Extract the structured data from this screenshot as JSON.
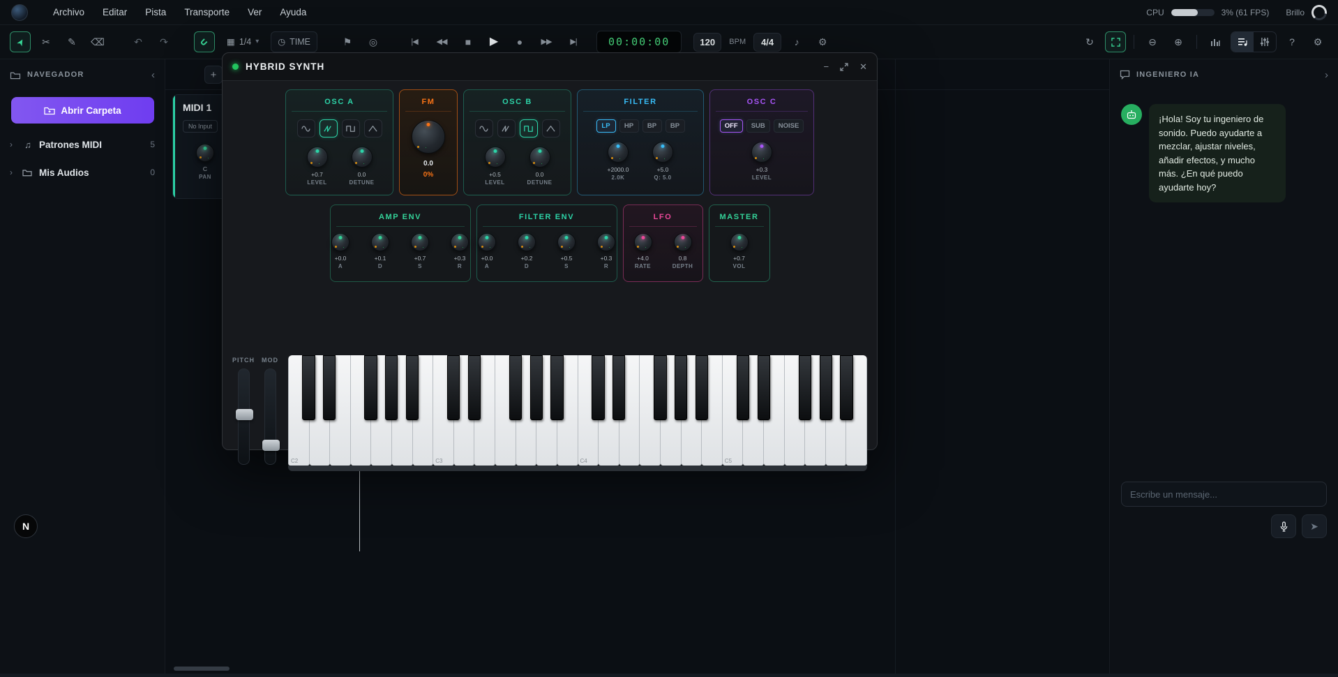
{
  "menubar": {
    "items": [
      "Archivo",
      "Editar",
      "Pista",
      "Transporte",
      "Ver",
      "Ayuda"
    ],
    "cpu_label": "CPU",
    "cpu_text": "3% (61 FPS)",
    "cpu_fill_pct": 62,
    "brightness_label": "Brillo"
  },
  "toolbar": {
    "grid_value": "1/4",
    "time_mode_label": "TIME",
    "timecode": "00:00:00",
    "tempo": "120",
    "tempo_unit": "BPM",
    "time_signature": "4/4"
  },
  "navigator": {
    "title": "NAVEGADOR",
    "open_folder_label": "Abrir Carpeta",
    "items": [
      {
        "label": "Patrones MIDI",
        "count": "5"
      },
      {
        "label": "Mis Audios",
        "count": "0"
      }
    ]
  },
  "timeline": {
    "add_track_label": "+",
    "track": {
      "name": "MIDI 1",
      "input_label": "No Input",
      "pan_value": "C",
      "pan_label": "PAN"
    }
  },
  "synth": {
    "title": "HYBRID SYNTH",
    "osc_a": {
      "title": "OSC A",
      "waves": [
        "sine",
        "saw",
        "square",
        "triangle"
      ],
      "selected_wave": 1,
      "knobs": [
        {
          "value": "+0.7",
          "label": "LEVEL"
        },
        {
          "value": "0.0",
          "label": "DETUNE"
        }
      ]
    },
    "fm": {
      "title": "FM",
      "value": "0.0",
      "amount": "0%"
    },
    "osc_b": {
      "title": "OSC B",
      "waves": [
        "sine",
        "saw",
        "square",
        "triangle"
      ],
      "selected_wave": 2,
      "knobs": [
        {
          "value": "+0.5",
          "label": "LEVEL"
        },
        {
          "value": "0.0",
          "label": "DETUNE"
        }
      ]
    },
    "filter": {
      "title": "FILTER",
      "modes": [
        "LP",
        "HP",
        "BP",
        "BP"
      ],
      "selected_mode": 0,
      "knobs": [
        {
          "value": "+2000.0",
          "label": "2.0K"
        },
        {
          "value": "+5.0",
          "label": "Q: 5.0"
        }
      ]
    },
    "osc_c": {
      "title": "OSC C",
      "modes": [
        "OFF",
        "SUB",
        "NOISE"
      ],
      "selected_mode": 0,
      "knobs": [
        {
          "value": "+0.3",
          "label": "LEVEL"
        }
      ]
    },
    "amp_env": {
      "title": "AMP ENV",
      "knobs": [
        {
          "value": "+0.0",
          "label": "A"
        },
        {
          "value": "+0.1",
          "label": "D"
        },
        {
          "value": "+0.7",
          "label": "S"
        },
        {
          "value": "+0.3",
          "label": "R"
        }
      ]
    },
    "filter_env": {
      "title": "FILTER ENV",
      "knobs": [
        {
          "value": "+0.0",
          "label": "A"
        },
        {
          "value": "+0.2",
          "label": "D"
        },
        {
          "value": "+0.5",
          "label": "S"
        },
        {
          "value": "+0.3",
          "label": "R"
        }
      ]
    },
    "lfo": {
      "title": "LFO",
      "knobs": [
        {
          "value": "+4.0",
          "label": "RATE"
        },
        {
          "value": "0.8",
          "label": "DEPTH"
        }
      ]
    },
    "master": {
      "title": "MASTER",
      "knobs": [
        {
          "value": "+0.7",
          "label": "VOL"
        }
      ]
    },
    "wheels": {
      "pitch_label": "PITCH",
      "mod_label": "MOD"
    },
    "keyboard": {
      "octaves": 4,
      "octave_labels": [
        "C2",
        "C3",
        "C4",
        "C5"
      ]
    }
  },
  "ai_panel": {
    "title": "INGENIERO IA",
    "message": "¡Hola! Soy tu ingeniero de sonido. Puedo ayudarte a mezclar, ajustar niveles, añadir efectos, y mucho más. ¿En qué puedo ayudarte hoy?",
    "input_placeholder": "Escribe un mensaje..."
  },
  "fab_label": "N",
  "colors": {
    "accent_green": "#34d399",
    "accent_teal": "#2dd4a8",
    "accent_orange": "#f97316",
    "accent_cyan": "#38bdf8",
    "accent_purple": "#a855f7",
    "accent_pink": "#ec4899",
    "accent_violet": "#7c4dff",
    "timecode_green": "#4ade80",
    "avatar_green": "#27ae60"
  },
  "icons": {
    "select": "➤",
    "scissors": "✂",
    "pencil": "✎",
    "eraser": "⌫",
    "undo": "↶",
    "redo": "↷",
    "magnet": "∪",
    "grid": "▦",
    "caret_down": "▾",
    "clock": "◷",
    "flag": "⚑",
    "loop_record": "◎",
    "skip_start": "|◀",
    "rewind": "◀◀",
    "stop": "■",
    "play": "▶",
    "record": "●",
    "forward": "▶▶",
    "skip_end": "▶|",
    "note": "♪",
    "gear": "⚙",
    "loop": "↻",
    "zoom_out": "⊖",
    "zoom_in": "⊕",
    "help": "?",
    "chevron_left": "‹",
    "chevron_right": "›",
    "plus": "+",
    "minimize": "−",
    "close": "✕",
    "send": "➤",
    "music_note": "♫"
  }
}
